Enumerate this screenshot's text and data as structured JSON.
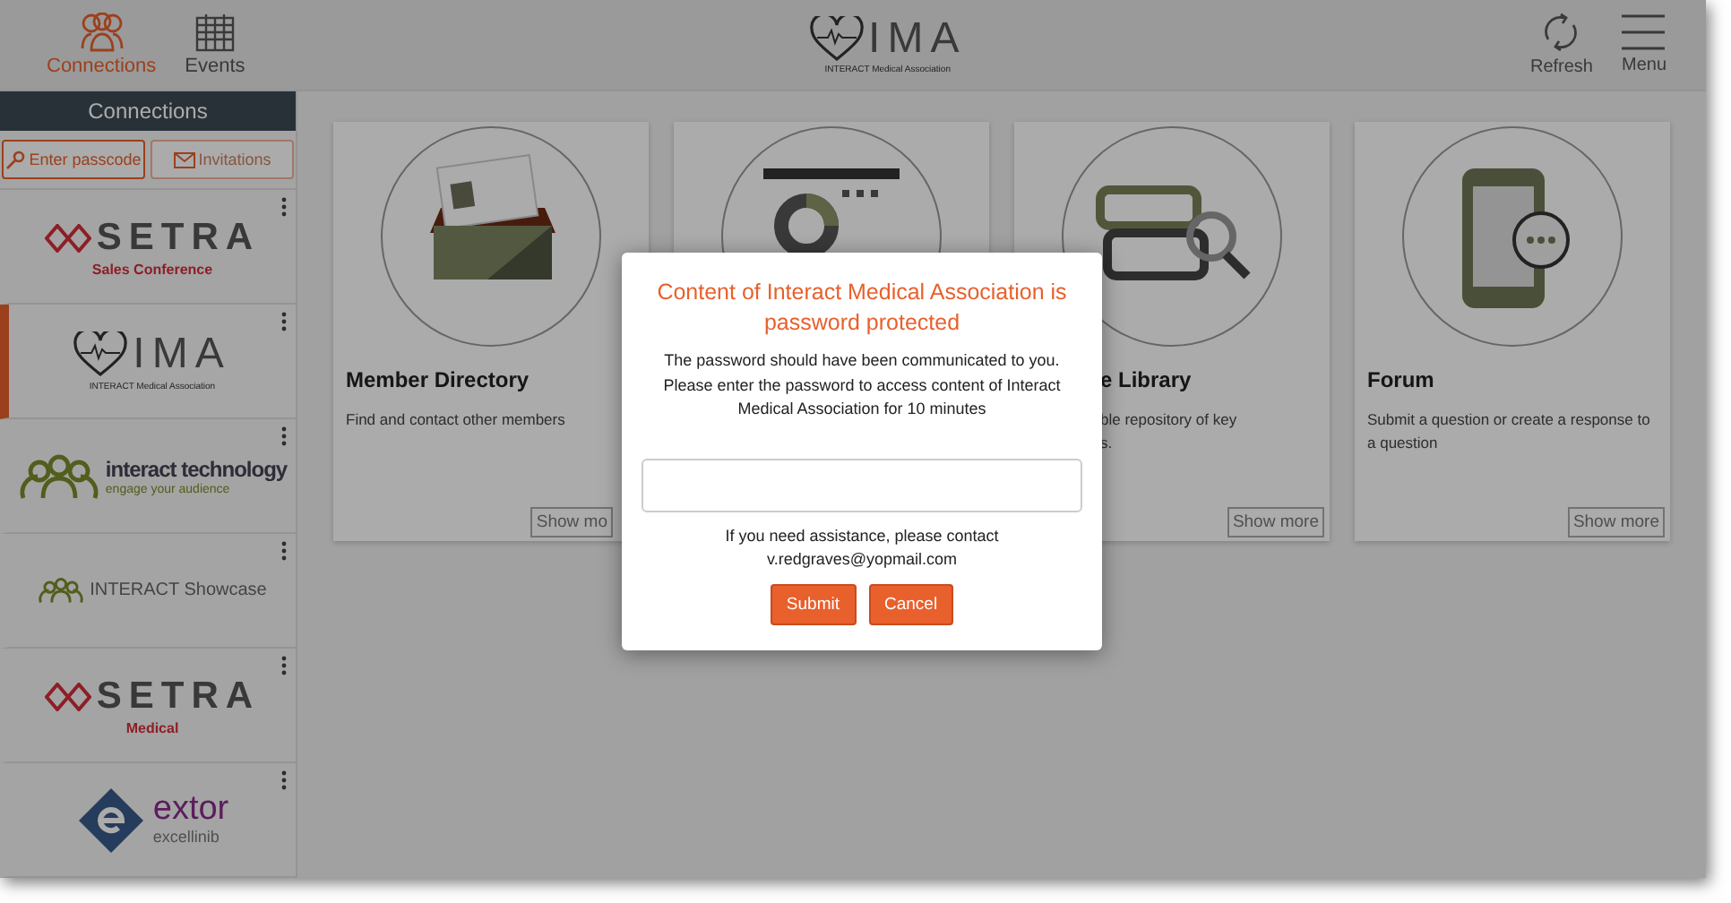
{
  "top_nav": {
    "tabs": [
      {
        "label": "Connections",
        "kind": "people",
        "selected": true
      },
      {
        "label": "Events",
        "kind": "calendar",
        "selected": false
      }
    ],
    "logo": {
      "mark": "IMA",
      "caption": "INTERACT Medical Association"
    },
    "actions": [
      {
        "label": "Refresh",
        "kind": "refresh"
      },
      {
        "label": "Menu",
        "kind": "menu"
      }
    ]
  },
  "sidebar": {
    "title": "Connections",
    "buttons": [
      {
        "label": "Enter passcode",
        "kind": "key",
        "disabled": false
      },
      {
        "label": "Invitations",
        "kind": "mail",
        "disabled": true
      }
    ],
    "items": [
      {
        "kind": "setra",
        "name": "SETRA",
        "caption": "Sales Conference",
        "selected": false
      },
      {
        "kind": "ima",
        "name": "IMA",
        "caption": "INTERACT Medical Association",
        "selected": true
      },
      {
        "kind": "interact",
        "name": "interact technology",
        "caption": "engage your audience",
        "selected": false
      },
      {
        "kind": "showcase",
        "name": "INTERACT Showcase",
        "selected": false
      },
      {
        "kind": "setra",
        "name": "SETRA",
        "caption": "Medical",
        "selected": false
      },
      {
        "kind": "extor",
        "name": "extor",
        "caption": "excellinib",
        "selected": false
      }
    ]
  },
  "cards": [
    {
      "kind": "directory",
      "title": "Member Directory",
      "description": "Find and contact other members",
      "button": "Show mo"
    },
    {
      "kind": "chart"
    },
    {
      "kind": "library",
      "title": "e Library",
      "description": "ble repository of key\ns.",
      "button": "Show more"
    },
    {
      "kind": "forum",
      "title": "Forum",
      "description": "Submit a question or create a response to a question",
      "button": "Show more"
    }
  ],
  "modal": {
    "title": "Content of Interact Medical Association is password protected",
    "message": "The password should have been communicated to you. Please enter the password to access content of Interact Medical Association for 10 minutes",
    "help": "If you need assistance, please contact v.redgraves@yopmail.com",
    "buttons": [
      "Submit",
      "Cancel"
    ]
  }
}
